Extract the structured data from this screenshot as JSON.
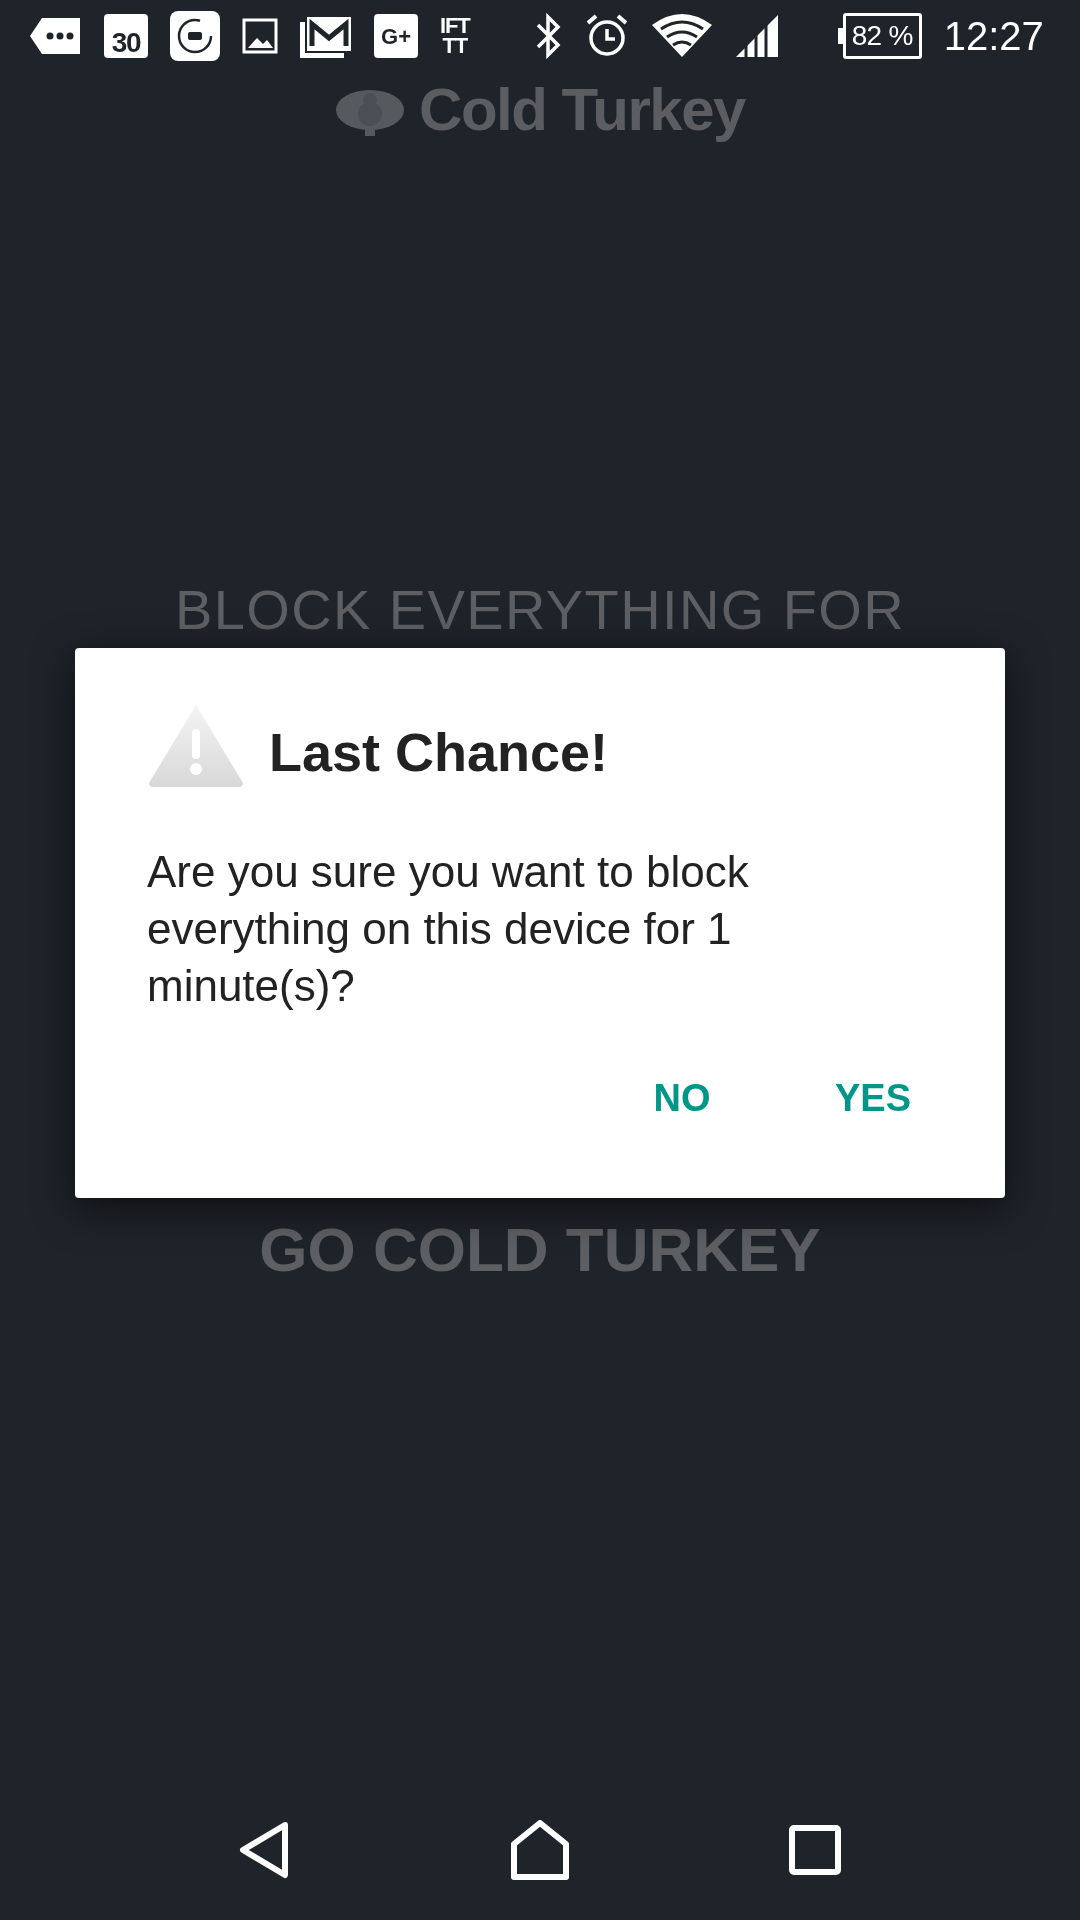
{
  "status_bar": {
    "calendar_day": "30",
    "google_plus": "G+",
    "ifttt": [
      "IFT",
      "TT"
    ],
    "battery": "82 %",
    "time": "12:27"
  },
  "app": {
    "logo_text": "Cold Turkey",
    "headline": "BLOCK EVERYTHING FOR",
    "go_button": "GO COLD TURKEY"
  },
  "dialog": {
    "title": "Last Chance!",
    "message": "Are you sure you want to block everything on this device for 1 minute(s)?",
    "buttons": [
      "NO",
      "YES"
    ]
  }
}
